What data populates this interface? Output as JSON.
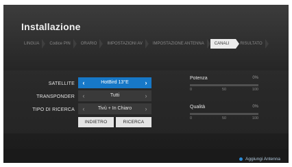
{
  "title": "Installazione",
  "steps": [
    {
      "label": "LINGUA",
      "active": false
    },
    {
      "label": "Codice PIN",
      "active": false
    },
    {
      "label": "ORARIO",
      "active": false
    },
    {
      "label": "IMPOSTAZIONI AV",
      "active": false
    },
    {
      "label": "IMPOSTAZIONE ANTENNA",
      "active": false
    },
    {
      "label": "CANALI",
      "active": true
    },
    {
      "label": "RISULTATO",
      "active": false
    }
  ],
  "form": {
    "satellite": {
      "label": "SATELLITE",
      "value": "HotBird 13°E"
    },
    "transponder": {
      "label": "TRANSPONDER",
      "value": "Tutti"
    },
    "search_type": {
      "label": "TIPO DI RICERCA",
      "value": "Tivù + In Chiaro"
    }
  },
  "buttons": {
    "back": "INDIETRO",
    "search": "RICERCA"
  },
  "meters": {
    "power": {
      "label": "Potenza",
      "value_text": "0%",
      "value": 0,
      "scale": [
        "0",
        "50",
        "100"
      ]
    },
    "quality": {
      "label": "Qualità",
      "value_text": "0%",
      "value": 0,
      "scale": [
        "0",
        "50",
        "100"
      ]
    }
  },
  "footer": {
    "add_antenna": "Aggiungi Antenna"
  },
  "colors": {
    "accent": "#1778c7"
  },
  "icons": {
    "left": "chevron-left-icon",
    "right": "chevron-right-icon",
    "dot": "blue-dot-icon"
  }
}
